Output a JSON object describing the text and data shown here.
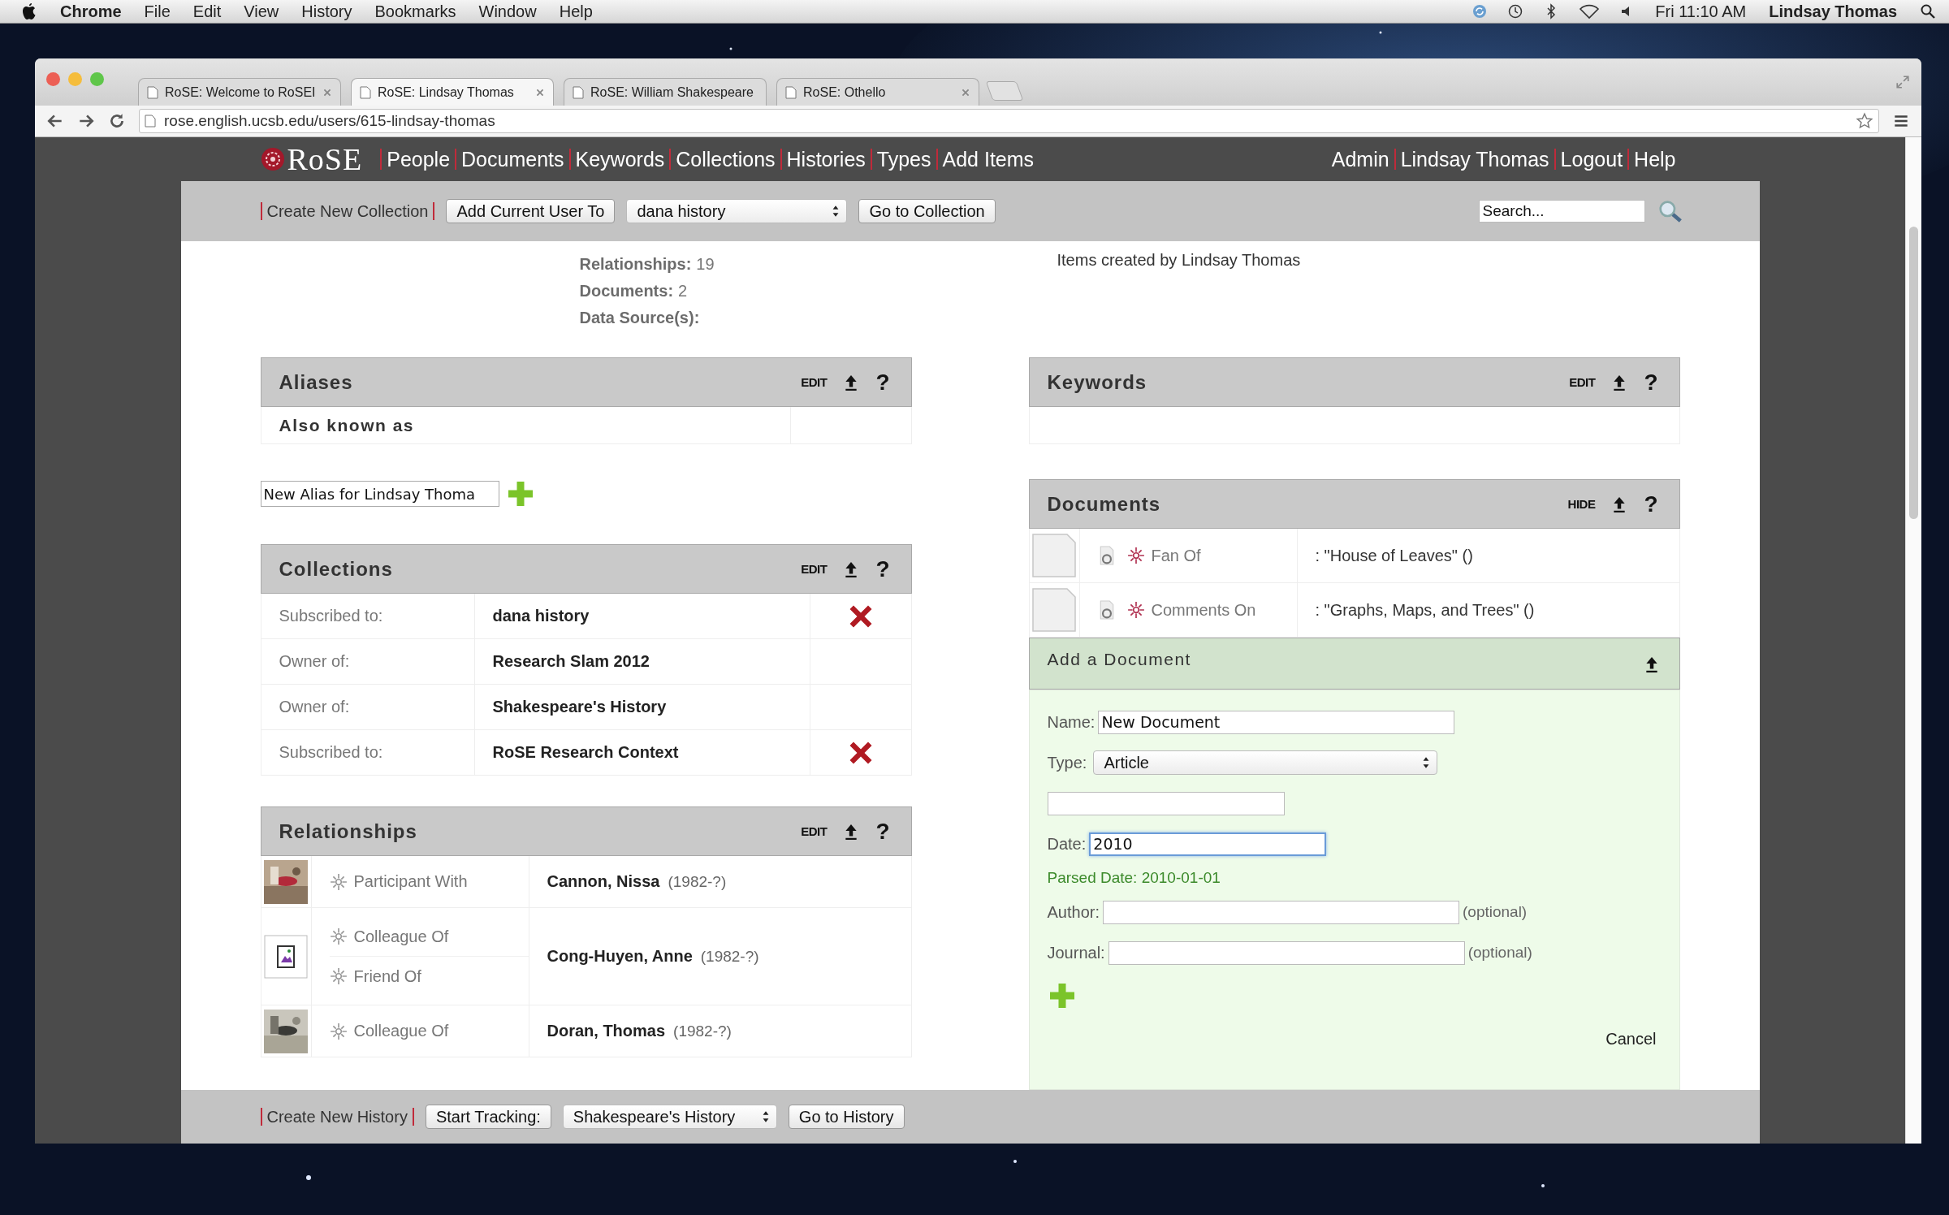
{
  "menu_bar": {
    "app": "Chrome",
    "items": [
      "File",
      "Edit",
      "View",
      "History",
      "Bookmarks",
      "Window",
      "Help"
    ],
    "clock": "Fri 11:10 AM",
    "user": "Lindsay Thomas"
  },
  "browser": {
    "tabs": [
      {
        "title": "RoSE: Welcome to RoSEI",
        "selected": false
      },
      {
        "title": "RoSE: Lindsay Thomas",
        "selected": true
      },
      {
        "title": "RoSE: William Shakespeare",
        "selected": false
      },
      {
        "title": "RoSE: Othello",
        "selected": false
      }
    ],
    "url": "rose.english.ucsb.edu/users/615-lindsay-thomas"
  },
  "site": {
    "logo": "RoSE",
    "nav": [
      "People",
      "Documents",
      "Keywords",
      "Collections",
      "Histories",
      "Types",
      "Add Items"
    ],
    "user_nav": [
      "Admin",
      "Lindsay Thomas",
      "Logout",
      "Help"
    ]
  },
  "collection_bar": {
    "create_link": "Create New Collection",
    "add_button": "Add Current User To",
    "select": "dana history",
    "go_button": "Go to Collection",
    "search_placeholder": "Search..."
  },
  "profile": {
    "stats": [
      {
        "label": "Relationships:",
        "value": "19"
      },
      {
        "label": "Documents:",
        "value": "2"
      },
      {
        "label": "Data Source(s):"
      }
    ],
    "items_created": "Items created by Lindsay Thomas"
  },
  "aliases": {
    "title": "Aliases",
    "action": "EDIT",
    "help": "?",
    "column": "Also known as",
    "new_alias": "New Alias for Lindsay Thoma"
  },
  "collections": {
    "title": "Collections",
    "action": "EDIT",
    "help": "?",
    "rows": [
      {
        "relation": "Subscribed to:",
        "name": "dana history",
        "removable": true
      },
      {
        "relation": "Owner of:",
        "name": "Research Slam 2012",
        "removable": false
      },
      {
        "relation": "Owner of:",
        "name": "Shakespeare's History",
        "removable": false
      },
      {
        "relation": "Subscribed to:",
        "name": "RoSE Research Context",
        "removable": true
      }
    ]
  },
  "relationships": {
    "title": "Relationships",
    "action": "EDIT",
    "help": "?",
    "rows": [
      {
        "kind": "picture",
        "relations": [
          "Participant With"
        ],
        "name": "Cannon, Nissa",
        "dates": "(1982-?)"
      },
      {
        "kind": "icon",
        "relations": [
          "Colleague Of",
          "Friend Of"
        ],
        "name": "Cong-Huyen, Anne",
        "dates": "(1982-?)"
      },
      {
        "kind": "picture",
        "relations": [
          "Colleague Of"
        ],
        "name": "Doran, Thomas",
        "dates": "(1982-?)"
      }
    ]
  },
  "keywords": {
    "title": "Keywords",
    "action": "EDIT",
    "help": "?"
  },
  "documents": {
    "title": "Documents",
    "action": "HIDE",
    "help": "?",
    "rows": [
      {
        "relation": "Fan Of",
        "title": ": \"House of Leaves\" ()"
      },
      {
        "relation": "Comments On",
        "title": ": \"Graphs, Maps, and Trees\" ()"
      }
    ]
  },
  "add_document": {
    "title": "Add a Document",
    "fields": [
      {
        "kind": "input",
        "label": "Name:",
        "value": "New Document",
        "focused": false
      },
      {
        "kind": "select",
        "label": "Type:",
        "value": "Article"
      },
      {
        "kind": "input",
        "focused": false
      },
      {
        "kind": "input",
        "label": "Date:",
        "value": "2010",
        "focused": true
      },
      {
        "kind": "note",
        "text": "Parsed Date: 2010-01-01"
      },
      {
        "kind": "input",
        "label": "Author:",
        "hint": "(optional)",
        "focused": false
      },
      {
        "kind": "input",
        "label": "Journal:",
        "hint": "(optional)",
        "focused": false
      }
    ],
    "cancel": "Cancel"
  },
  "history_bar": {
    "create_link": "Create New History",
    "start_button": "Start Tracking:",
    "select": "Shakespeare's History",
    "go_button": "Go to History"
  }
}
